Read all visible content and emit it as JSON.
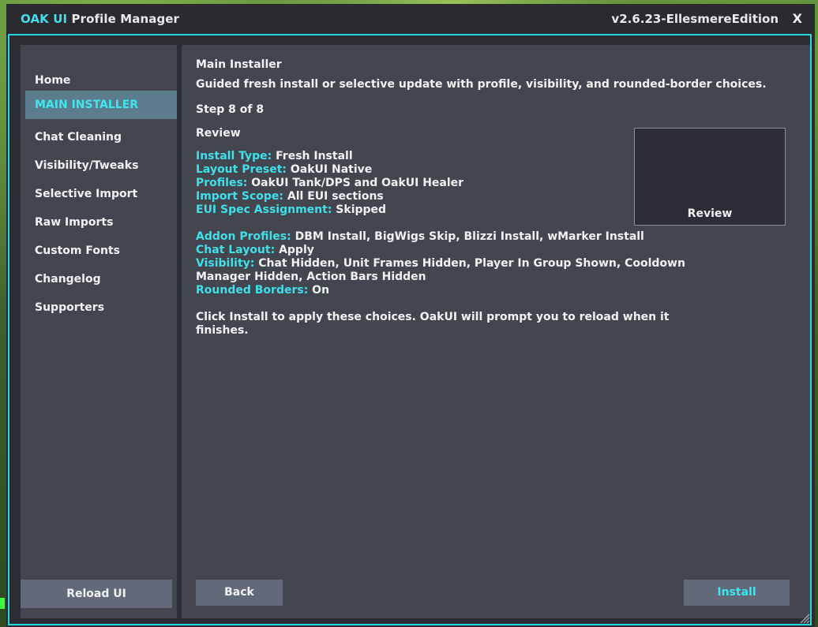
{
  "window": {
    "brand": "OAK UI",
    "title": "Profile Manager",
    "version": "v2.6.23-EllesmereEdition",
    "close_label": "X"
  },
  "sidebar": {
    "items": [
      {
        "label": "Home",
        "active": false
      },
      {
        "label": "MAIN INSTALLER",
        "active": true
      },
      {
        "label": "Chat Cleaning",
        "active": false
      },
      {
        "label": "Visibility/Tweaks",
        "active": false
      },
      {
        "label": "Selective Import",
        "active": false
      },
      {
        "label": "Raw Imports",
        "active": false
      },
      {
        "label": "Custom Fonts",
        "active": false
      },
      {
        "label": "Changelog",
        "active": false
      },
      {
        "label": "Supporters",
        "active": false
      }
    ],
    "reload_label": "Reload UI"
  },
  "content": {
    "heading": "Main Installer",
    "description": "Guided fresh install or selective update with profile, visibility, and rounded-border choices.",
    "step": "Step 8 of 8",
    "section_title": "Review",
    "summary_group1": [
      {
        "label": "Install Type:",
        "value": "Fresh Install"
      },
      {
        "label": "Layout Preset:",
        "value": "OakUI Native"
      },
      {
        "label": "Profiles:",
        "value": "OakUI Tank/DPS and OakUI Healer"
      },
      {
        "label": "Import Scope:",
        "value": "All EUI sections"
      },
      {
        "label": "EUI Spec Assignment:",
        "value": "Skipped"
      }
    ],
    "summary_group2": [
      {
        "label": "Addon Profiles:",
        "value": "DBM Install, BigWigs Skip, Blizzi Install, wMarker Install"
      },
      {
        "label": "Chat Layout:",
        "value": "Apply"
      },
      {
        "label": "Visibility:",
        "value": "Chat Hidden, Unit Frames Hidden, Player In Group Shown, Cooldown"
      },
      {
        "label": "",
        "value": "Manager Hidden, Action Bars Hidden"
      },
      {
        "label": "Rounded Borders:",
        "value": "On"
      }
    ],
    "footer_note_line1": "Click Install to apply these choices. OakUI will prompt you to reload when it",
    "footer_note_line2": "finishes.",
    "preview_label": "Review",
    "back_label": "Back",
    "install_label": "Install"
  },
  "colors": {
    "accent": "#3fe0ea",
    "border": "#2ad6dc",
    "panel": "#43464f",
    "button": "#626a7a",
    "active_item": "#5b7d8e"
  },
  "icons": {
    "resize": "resize-grip-icon"
  }
}
